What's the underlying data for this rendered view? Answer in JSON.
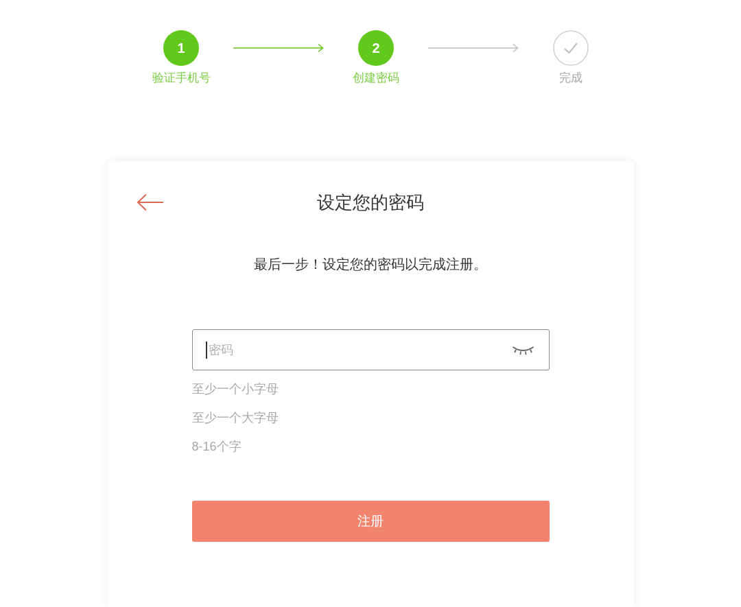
{
  "steps": [
    {
      "kind": "number",
      "number": "1",
      "label": "验证手机号",
      "reached": true
    },
    {
      "kind": "number",
      "number": "2",
      "label": "创建密码",
      "reached": true
    },
    {
      "kind": "check",
      "label": "完成",
      "reached": false
    }
  ],
  "card": {
    "title": "设定您的密码",
    "subtitle": "最后一步！设定您的密码以完成注册。",
    "password": {
      "placeholder": "密码",
      "focused": true,
      "masked": true
    },
    "requirements": [
      {
        "text": "至少一个小字母",
        "met": false
      },
      {
        "text": "至少一个大字母",
        "met": false
      },
      {
        "text": "8-16个字",
        "met": false
      }
    ],
    "submit": "注册"
  }
}
